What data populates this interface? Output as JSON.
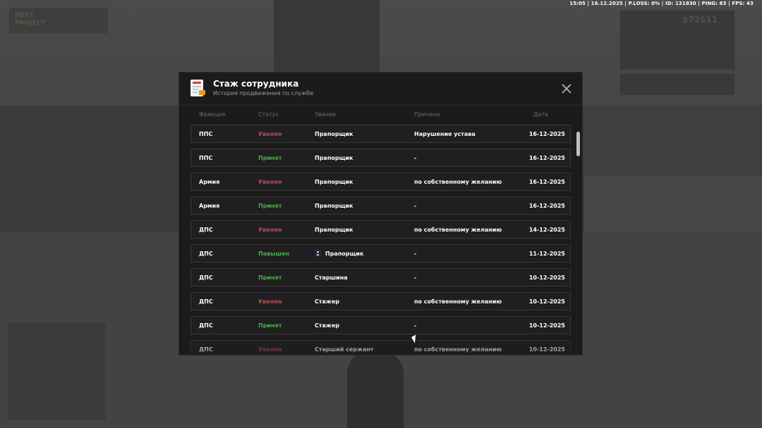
{
  "hud": {
    "status_line": "15:05 | 16.12.2025 | P.LOSS: 0% | ID: 131830 | PING: 83 | FPS: 43",
    "money": "$72611"
  },
  "logo": {
    "line1": "NEXT",
    "line2": "PROJECT"
  },
  "modal": {
    "title": "Стаж сотрудника",
    "subtitle": "История продвижения по службе",
    "columns": {
      "faction": "Фракция",
      "status": "Статус",
      "rank": "Звание",
      "reason": "Причина",
      "date": "Дата"
    },
    "rows": [
      {
        "faction": "ППС",
        "status": "Уволен",
        "rank": "Прапорщик",
        "reason": "Нарушение устава",
        "date": "16-12-2025"
      },
      {
        "faction": "ППС",
        "status": "Принят",
        "rank": "Прапорщик",
        "reason": "-",
        "date": "16-12-2025"
      },
      {
        "faction": "Армия",
        "status": "Уволен",
        "rank": "Прапорщик",
        "reason": "по собственному желанию",
        "date": "16-12-2025"
      },
      {
        "faction": "Армия",
        "status": "Принят",
        "rank": "Прапорщик",
        "reason": "-",
        "date": "16-12-2025"
      },
      {
        "faction": "ДПС",
        "status": "Уволен",
        "rank": "Прапорщик",
        "reason": "по собственному желанию",
        "date": "14-12-2025"
      },
      {
        "faction": "ДПС",
        "status": "Повышен",
        "rank": "Прапорщик",
        "reason": "-",
        "date": "11-12-2025"
      },
      {
        "faction": "ДПС",
        "status": "Принят",
        "rank": "Старшина",
        "reason": "-",
        "date": "10-12-2025"
      },
      {
        "faction": "ДПС",
        "status": "Уволен",
        "rank": "Стажер",
        "reason": "по собственному желанию",
        "date": "10-12-2025"
      },
      {
        "faction": "ДПС",
        "status": "Принят",
        "rank": "Стажер",
        "reason": "-",
        "date": "10-12-2025"
      },
      {
        "faction": "ДПС",
        "status": "Уволен",
        "rank": "Старший сержант",
        "reason": "по собственному желанию",
        "date": "10-12-2025"
      }
    ],
    "colors": {
      "dismissed": "#c94a4a",
      "accepted": "#4caf47",
      "promoted": "#4caf47"
    },
    "icons": {
      "header": "document-icon",
      "close": "close-icon",
      "rank_promoted": "rank-insignia-icon"
    }
  }
}
